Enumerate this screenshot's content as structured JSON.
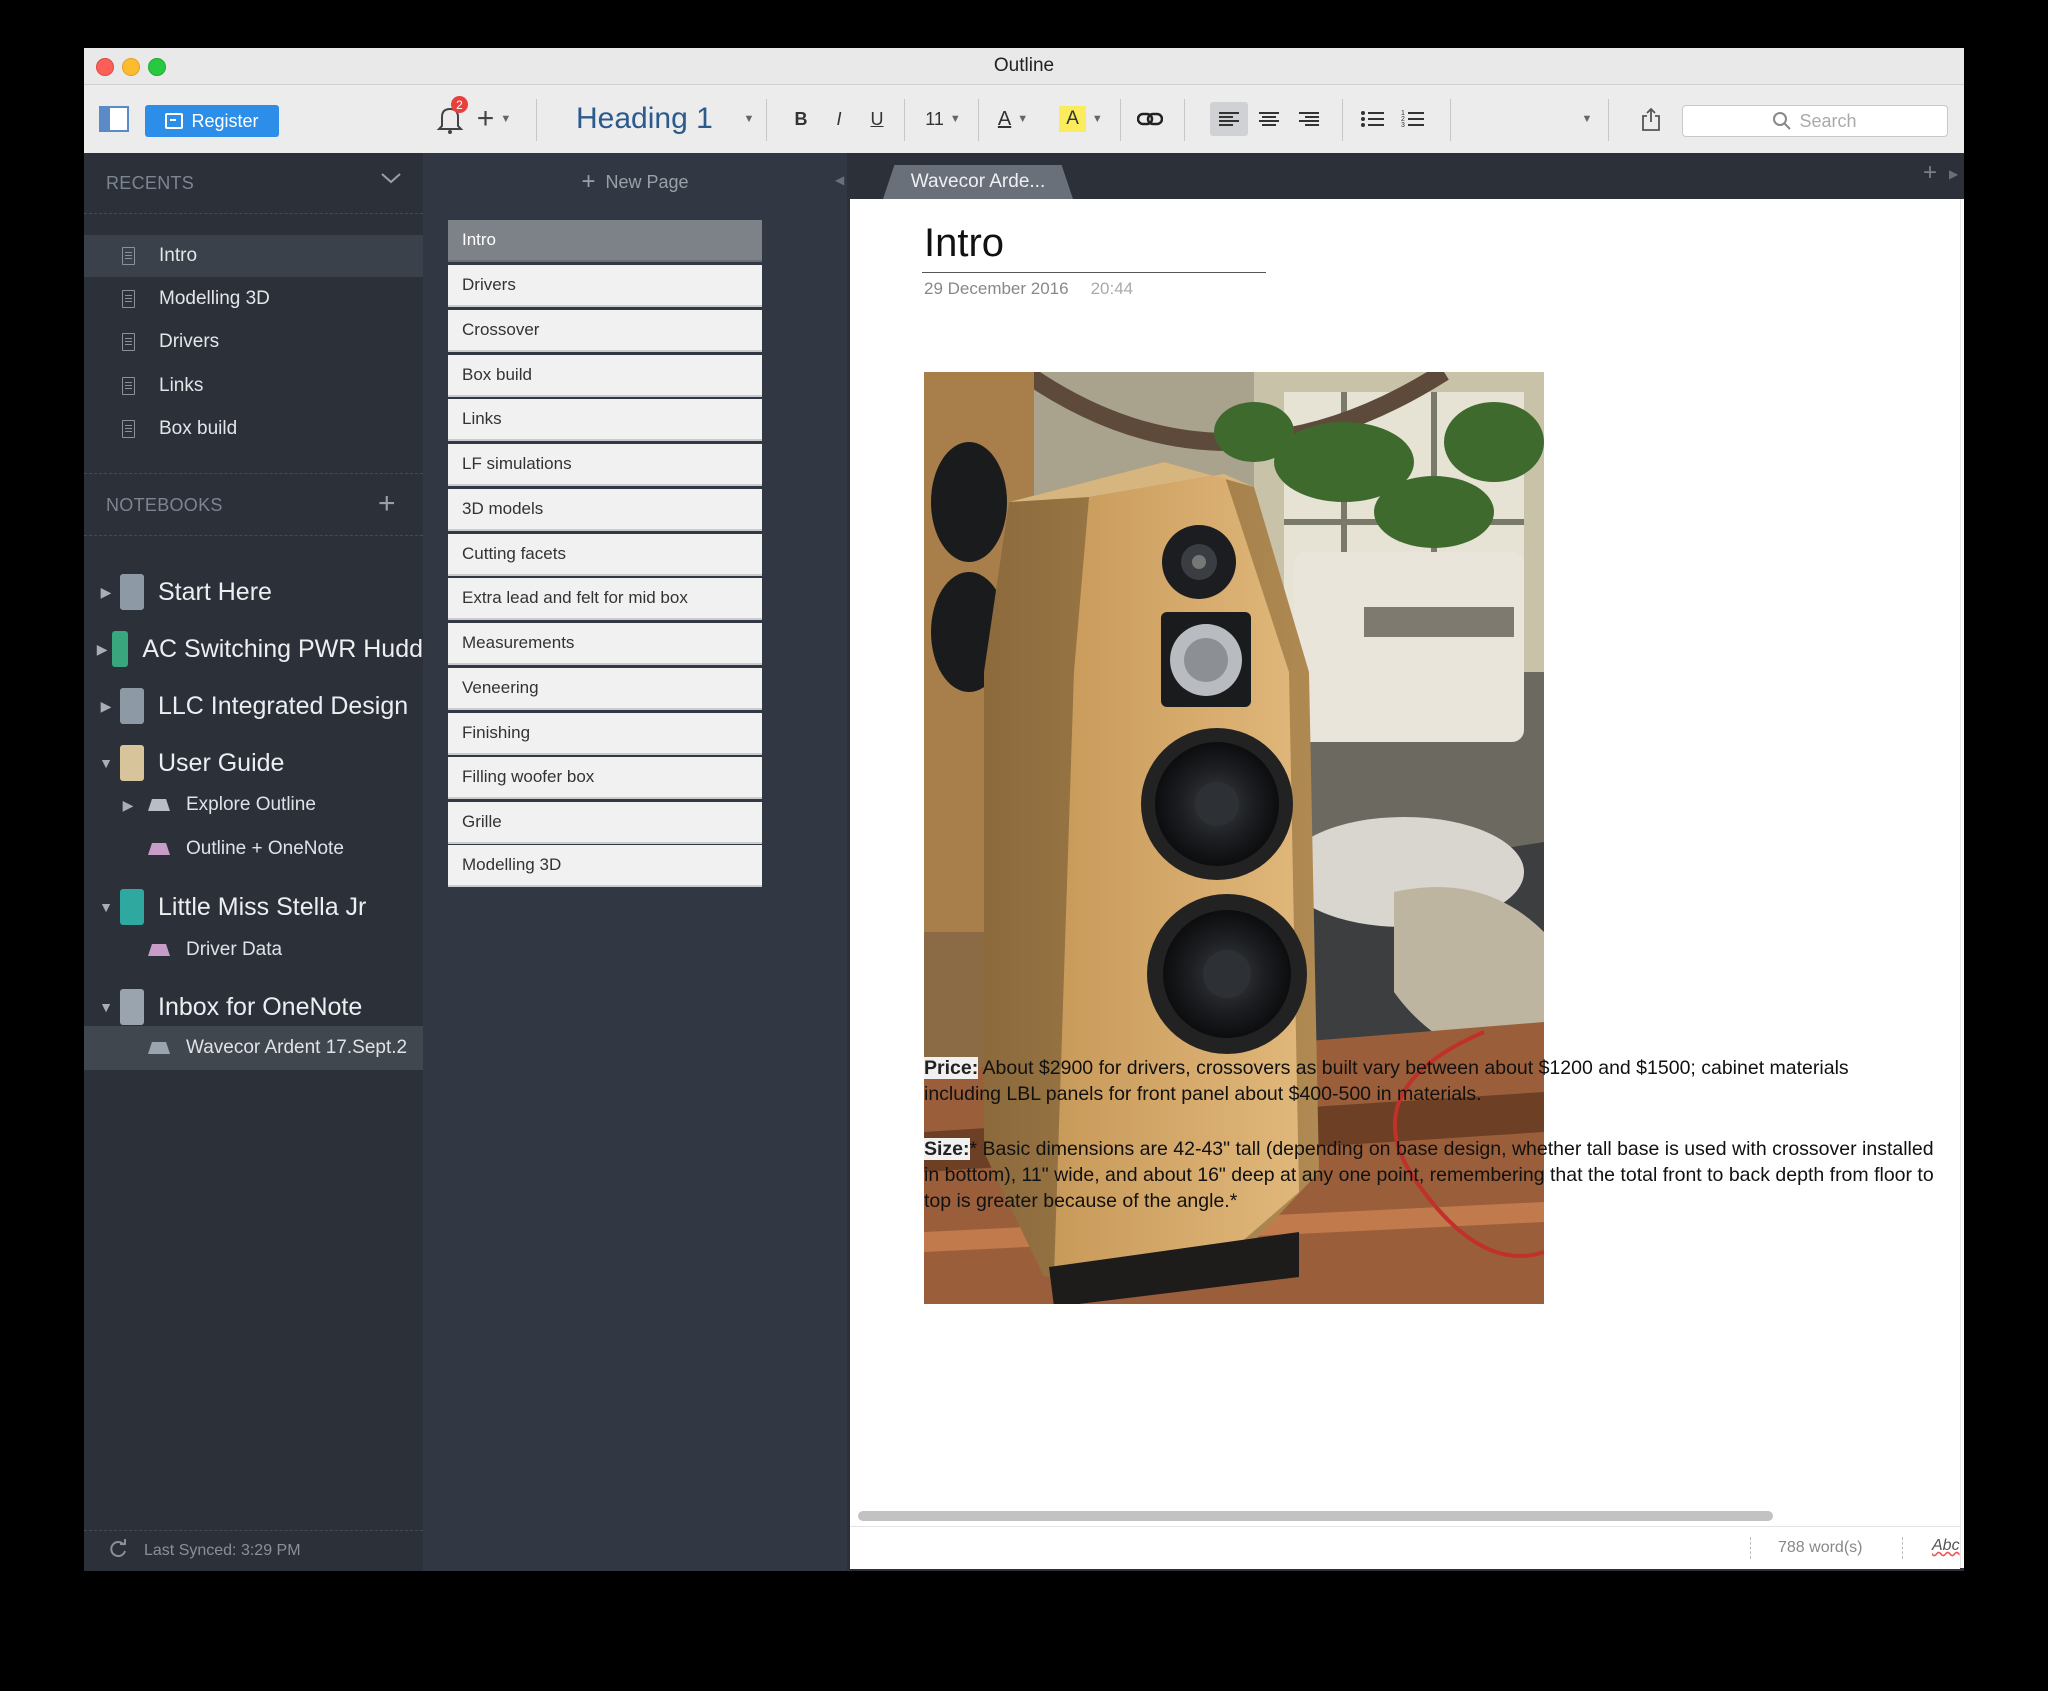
{
  "app": {
    "title": "Outline"
  },
  "toolbar": {
    "register_label": "Register",
    "notification_count": "2",
    "style_label": "Heading 1",
    "bold": "B",
    "italic": "I",
    "underline": "U",
    "font_size": "11",
    "text_color_label": "A",
    "highlight_label": "A",
    "search_placeholder": "Search"
  },
  "sidebar": {
    "recents_header": "RECENTS",
    "recents": [
      {
        "label": "Intro"
      },
      {
        "label": "Modelling 3D"
      },
      {
        "label": "Drivers"
      },
      {
        "label": "Links"
      },
      {
        "label": "Box build"
      }
    ],
    "notebooks_header": "NOTEBOOKS",
    "notebooks": [
      {
        "label": "Start Here",
        "color": "#8d9aa6"
      },
      {
        "label": "AC Switching PWR Hudd",
        "color": "#3aa67d"
      },
      {
        "label": "LLC Integrated Design",
        "color": "#8d9aa6"
      },
      {
        "label": "User Guide",
        "color": "#d8c49b"
      },
      {
        "label": "Explore Outline",
        "color": "#b8bec6"
      },
      {
        "label": "Outline + OneNote",
        "color": "#c79cc7"
      },
      {
        "label": "Little Miss Stella Jr",
        "color": "#2fa9a0"
      },
      {
        "label": "Driver Data",
        "color": "#c79cc7"
      },
      {
        "label": "Inbox for OneNote",
        "color": "#9aa4ae"
      },
      {
        "label": "Wavecor Ardent 17.Sept.2",
        "color": "#9aa4ae"
      }
    ],
    "last_synced": "Last Synced: 3:29 PM"
  },
  "pagelist": {
    "new_page_label": "New Page",
    "pages": [
      "Intro",
      "Drivers",
      "Crossover",
      "Box build",
      "Links",
      "LF simulations",
      "3D models",
      "Cutting facets",
      "Extra lead and felt for mid box",
      "Measurements",
      "Veneering",
      "Finishing",
      "Filling woofer box",
      "Grille",
      "Modelling 3D"
    ]
  },
  "editor": {
    "tab_label": "Wavecor Arde...",
    "title": "Intro",
    "date": "29 December 2016",
    "time": "20:44",
    "price_label": "Price:",
    "price_text": " About $2900 for drivers, crossovers as built vary between about $1200 and $1500; cabinet materials including LBL panels for front panel about $400-500 in materials.",
    "size_label": "Size:",
    "size_text": "* Basic dimensions are 42-43\" tall (depending on base design, whether tall base is used with crossover installed in bottom), 11\" wide, and about 16\" deep at any one point, remembering that the total front to back depth from floor to top is greater because of the angle.*",
    "word_count": "788 word(s)",
    "spell_label": "Abc"
  }
}
